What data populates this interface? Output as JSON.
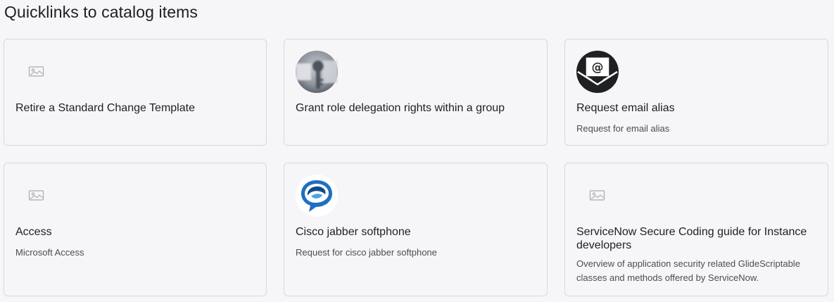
{
  "section": {
    "title": "Quicklinks to catalog items"
  },
  "cards": [
    {
      "title": "Retire a Standard Change Template",
      "description": "",
      "icon": "image-placeholder-icon"
    },
    {
      "title": "Grant role delegation rights within a group",
      "description": "",
      "icon": "key-icon"
    },
    {
      "title": "Request email alias",
      "description": "Request for email alias",
      "icon": "email-at-icon"
    },
    {
      "title": "Access",
      "description": "Microsoft Access",
      "icon": "image-placeholder-icon"
    },
    {
      "title": "Cisco jabber softphone",
      "description": "Request for cisco jabber softphone",
      "icon": "cisco-jabber-icon"
    },
    {
      "title": "ServiceNow Secure Coding guide for Instance developers",
      "description": "Overview of application security related GlideScriptable classes and methods offered by ServiceNow.",
      "icon": "image-placeholder-icon"
    }
  ],
  "colors": {
    "background": "#f6f6f8",
    "card_border": "#d7d8dc",
    "title_text": "#1d1f22",
    "description_text": "#4a4d52",
    "jabber_blue": "#1e6fc2"
  }
}
